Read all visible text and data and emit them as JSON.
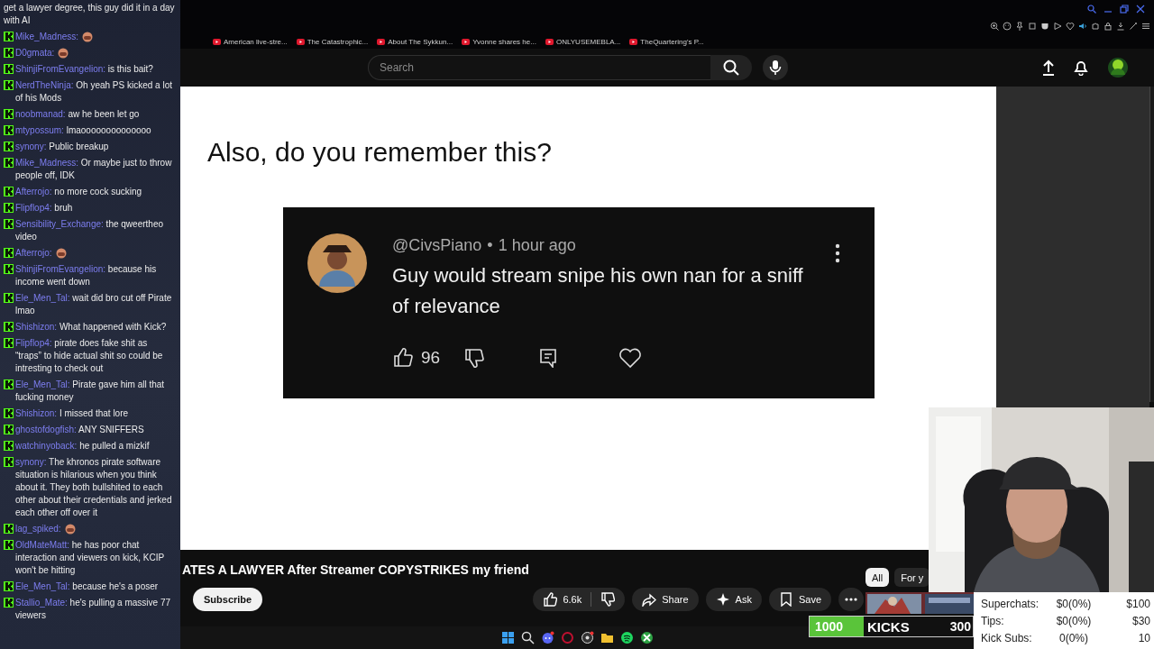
{
  "browser": {
    "bookmarks": [
      {
        "label": "American live-stre..."
      },
      {
        "label": "The Catastrophic..."
      },
      {
        "label": "About The Sykkun..."
      },
      {
        "label": "Yvonne shares he..."
      },
      {
        "label": "ONLYUSEMEBLA..."
      },
      {
        "label": "TheQuartering's P..."
      }
    ]
  },
  "header": {
    "search": {
      "placeholder": "Search"
    }
  },
  "slide": {
    "heading": "Also, do you remember this?",
    "comment": {
      "handle": "@CivsPiano",
      "separator": "•",
      "time": "1 hour ago",
      "text": "Guy would stream snipe his own nan for a sniff of relevance",
      "likes": "96"
    }
  },
  "video": {
    "title": "ATES A LAWYER After Streamer COPYSTRIKES my friend",
    "subscribe": "Subscribe",
    "likes": "6.6k",
    "actions": [
      {
        "kind": "share",
        "label": "Share"
      },
      {
        "kind": "ask",
        "label": "Ask"
      },
      {
        "kind": "save",
        "label": "Save"
      }
    ]
  },
  "chips": [
    {
      "label": "All",
      "selected": true
    },
    {
      "label": "For y",
      "selected": false
    }
  ],
  "chat": [
    {
      "kind": "continued",
      "text": "get a lawyer degree, this guy did it in a day with AI"
    },
    {
      "kind": "emote",
      "user": "Mike_Madness:"
    },
    {
      "kind": "emote",
      "user": "D0gmata:"
    },
    {
      "kind": "message",
      "user": "ShinjiFromEvangelion:",
      "text": "is this bait?"
    },
    {
      "kind": "message",
      "user": "NerdTheNinja:",
      "text": "Oh yeah PS kicked a lot of his Mods"
    },
    {
      "kind": "message",
      "user": "noobmanad:",
      "text": "aw he been let go"
    },
    {
      "kind": "message",
      "user": "mtypossum:",
      "text": "lmaoooooooooooooo"
    },
    {
      "kind": "message",
      "user": "synony:",
      "text": "Public breakup"
    },
    {
      "kind": "message",
      "user": "Mike_Madness:",
      "text": "Or maybe just to throw people off, IDK"
    },
    {
      "kind": "message",
      "user": "Afterrojo:",
      "text": "no more cock sucking"
    },
    {
      "kind": "message",
      "user": "Flipflop4:",
      "text": "bruh"
    },
    {
      "kind": "message",
      "user": "Sensibility_Exchange:",
      "text": "the qweertheo video"
    },
    {
      "kind": "emote",
      "user": "Afterrojo:"
    },
    {
      "kind": "message",
      "user": "ShinjiFromEvangelion:",
      "text": "because his income went down"
    },
    {
      "kind": "message",
      "user": "Ele_Men_Tal:",
      "text": "wait did bro cut off Pirate lmao"
    },
    {
      "kind": "message",
      "user": "Shishizon:",
      "text": "What happened with Kick?"
    },
    {
      "kind": "message",
      "user": "Flipflop4:",
      "text": "pirate does fake shit as “traps” to hide actual shit so could be intresting to check out"
    },
    {
      "kind": "message",
      "user": "Ele_Men_Tal:",
      "text": "Pirate gave him all that fucking money"
    },
    {
      "kind": "message",
      "user": "Shishizon:",
      "text": "I missed that lore"
    },
    {
      "kind": "message",
      "user": "ghostofdogfish:",
      "text": "ANY SNIFFERS"
    },
    {
      "kind": "message",
      "user": "watchinyoback:",
      "text": "he pulled a mizkif"
    },
    {
      "kind": "message",
      "user": "synony:",
      "text": "The khronos pirate software situation is hilarious when you think about it. They both bullshited to each other about their credentials and jerked each other off over it"
    },
    {
      "kind": "emote",
      "user": "lag_spiked:"
    },
    {
      "kind": "message",
      "user": "OldMateMatt:",
      "text": "he has poor chat interaction and viewers on kick, KCIP won't be hitting"
    },
    {
      "kind": "message",
      "user": "Ele_Men_Tal:",
      "text": "because he's a poser"
    },
    {
      "kind": "message",
      "user": "Stallio_Mate:",
      "text": "he's pulling a massive 77 viewers"
    }
  ],
  "stream": {
    "kicks": {
      "count": "1000",
      "label": "KICKS",
      "goal": "300",
      "level": 0.33
    },
    "goals": [
      {
        "label": "Superchats:",
        "value": "$0(0%)",
        "target": "$100"
      },
      {
        "label": "Tips:",
        "value": "$0(0%)",
        "target": "$30"
      },
      {
        "label": "Kick Subs:",
        "value": "0(0%)",
        "target": "10"
      }
    ]
  }
}
